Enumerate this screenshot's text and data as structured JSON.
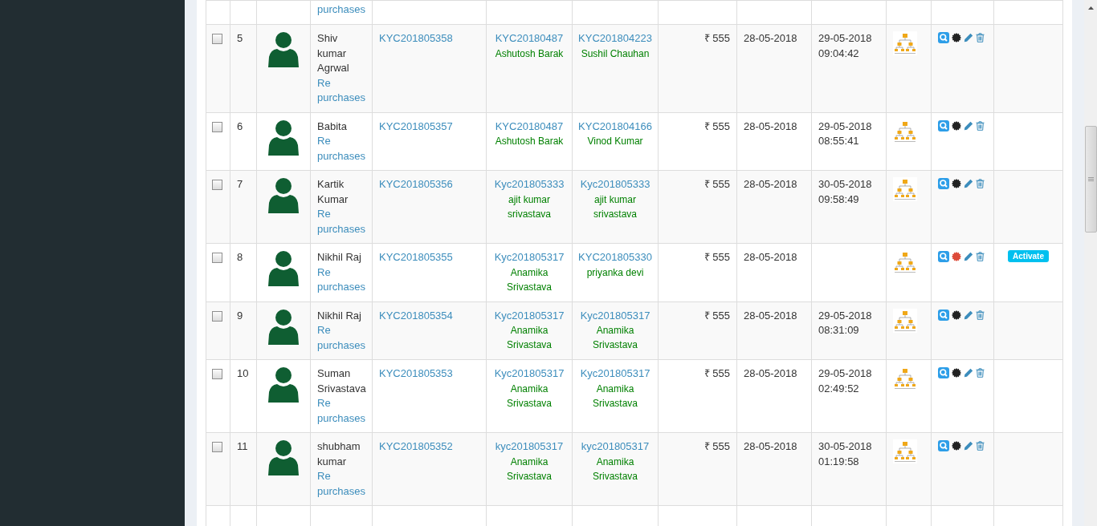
{
  "top_row_partial": {
    "link": "purchases"
  },
  "rows": [
    {
      "checked": false,
      "number": "5",
      "name": "Shiv kumar Agrwal",
      "link": "Re purchases",
      "id": "KYC201805358",
      "sponsor": {
        "id": "KYC20180487",
        "name": "Ashutosh Barak"
      },
      "upline": {
        "id": "KYC201804223",
        "name": "Sushil Chauhan"
      },
      "amount": "₹ 555",
      "joined": "28-05-2018",
      "activated": {
        "date": "29-05-2018",
        "time": "09:04:42"
      },
      "active": true
    },
    {
      "checked": false,
      "number": "6",
      "name": "Babita",
      "link": "Re purchases",
      "id": "KYC201805357",
      "sponsor": {
        "id": "KYC20180487",
        "name": "Ashutosh Barak"
      },
      "upline": {
        "id": "KYC201804166",
        "name": "Vinod Kumar"
      },
      "amount": "₹ 555",
      "joined": "28-05-2018",
      "activated": {
        "date": "29-05-2018",
        "time": "08:55:41"
      },
      "active": true
    },
    {
      "checked": false,
      "number": "7",
      "name": "Kartik Kumar",
      "link": "Re purchases",
      "id": "KYC201805356",
      "sponsor": {
        "id": "Kyc201805333",
        "name": "ajit kumar srivastava"
      },
      "upline": {
        "id": "Kyc201805333",
        "name": "ajit kumar srivastava"
      },
      "amount": "₹ 555",
      "joined": "28-05-2018",
      "activated": {
        "date": "30-05-2018",
        "time": "09:58:49"
      },
      "active": true
    },
    {
      "checked": false,
      "number": "8",
      "name": "Nikhil Raj",
      "link": "Re purchases",
      "id": "KYC201805355",
      "sponsor": {
        "id": "Kyc201805317",
        "name": "Anamika Srivastava"
      },
      "upline": {
        "id": "KYC201805330",
        "name": "priyanka devi"
      },
      "amount": "₹ 555",
      "joined": "28-05-2018",
      "active": false,
      "action_button": "Activate"
    },
    {
      "checked": false,
      "number": "9",
      "name": "Nikhil Raj",
      "link": "Re purchases",
      "id": "KYC201805354",
      "sponsor": {
        "id": "Kyc201805317",
        "name": "Anamika Srivastava"
      },
      "upline": {
        "id": "Kyc201805317",
        "name": "Anamika Srivastava"
      },
      "amount": "₹ 555",
      "joined": "28-05-2018",
      "activated": {
        "date": "29-05-2018",
        "time": "08:31:09"
      },
      "active": true
    },
    {
      "checked": false,
      "number": "10",
      "name": "Suman Srivastava",
      "link": "Re purchases",
      "id": "KYC201805353",
      "sponsor": {
        "id": "Kyc201805317",
        "name": "Anamika Srivastava"
      },
      "upline": {
        "id": "Kyc201805317",
        "name": "Anamika Srivastava"
      },
      "amount": "₹ 555",
      "joined": "28-05-2018",
      "activated": {
        "date": "29-05-2018",
        "time": "02:49:52"
      },
      "active": true
    },
    {
      "checked": false,
      "number": "11",
      "name": "shubham kumar",
      "link": "Re purchases",
      "id": "KYC201805352",
      "sponsor": {
        "id": "kyc201805317",
        "name": "Anamika Srivastava"
      },
      "upline": {
        "id": "kyc201805317",
        "name": "Anamika Srivastava"
      },
      "amount": "₹ 555",
      "joined": "28-05-2018",
      "activated": {
        "date": "30-05-2018",
        "time": "01:19:58"
      },
      "active": true
    }
  ]
}
